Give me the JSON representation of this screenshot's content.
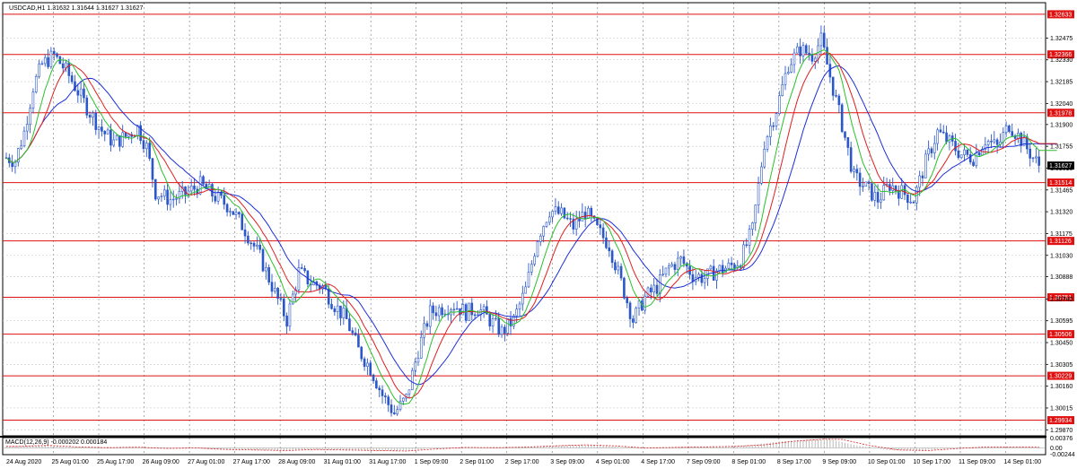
{
  "chart_data": {
    "type": "candlestick",
    "header": {
      "symbol": "USDCAD,H1",
      "ohlc": "1.31632 1.31644 1.31627 1.31627"
    },
    "price_axis": {
      "ylim": [
        1.2983,
        1.3271
      ],
      "ticks": [
        "1.32475",
        "1.32330",
        "1.32185",
        "1.32040",
        "1.31900",
        "1.31755",
        "1.31610",
        "1.31465",
        "1.31320",
        "1.31175",
        "1.31030",
        "1.30888",
        "1.30740",
        "1.30595",
        "1.30450",
        "1.30305",
        "1.30160",
        "1.30015",
        "1.29870"
      ],
      "current_price": "1.31627"
    },
    "levels": [
      {
        "label": "1.32633",
        "value": 1.32633
      },
      {
        "label": "1.32366",
        "value": 1.32366
      },
      {
        "label": "1.31978",
        "value": 1.31978
      },
      {
        "label": "1.31514",
        "value": 1.31514
      },
      {
        "label": "1.31126",
        "value": 1.31126
      },
      {
        "label": "1.30751",
        "value": 1.30751
      },
      {
        "label": "1.30506",
        "value": 1.30506
      },
      {
        "label": "1.30229",
        "value": 1.30229
      },
      {
        "label": "1.29934",
        "value": 1.29934
      }
    ],
    "time_labels": [
      "24 Aug 2020",
      "25 Aug 01:00",
      "25 Aug 17:00",
      "26 Aug 09:00",
      "27 Aug 01:00",
      "27 Aug 17:00",
      "28 Aug 09:00",
      "31 Aug 01:00",
      "31 Aug 17:00",
      "1 Sep 09:00",
      "2 Sep 01:00",
      "2 Sep 17:00",
      "3 Sep 09:00",
      "4 Sep 01:00",
      "4 Sep 17:00",
      "7 Sep 09:00",
      "8 Sep 01:00",
      "8 Sep 17:00",
      "9 Sep 09:00",
      "10 Sep 01:00",
      "10 Sep 17:00",
      "11 Sep 09:00",
      "14 Sep 01:00"
    ],
    "series_anchors": [
      [
        0,
        1.3168
      ],
      [
        3,
        1.3166
      ],
      [
        6,
        1.3185
      ],
      [
        9,
        1.3215
      ],
      [
        12,
        1.323
      ],
      [
        16,
        1.3236
      ],
      [
        20,
        1.3226
      ],
      [
        24,
        1.3212
      ],
      [
        28,
        1.3198
      ],
      [
        32,
        1.3186
      ],
      [
        36,
        1.3178
      ],
      [
        40,
        1.3182
      ],
      [
        44,
        1.3188
      ],
      [
        47,
        1.3175
      ],
      [
        50,
        1.3145
      ],
      [
        55,
        1.314
      ],
      [
        60,
        1.3144
      ],
      [
        65,
        1.315
      ],
      [
        70,
        1.3142
      ],
      [
        75,
        1.3135
      ],
      [
        80,
        1.312
      ],
      [
        85,
        1.3102
      ],
      [
        90,
        1.3078
      ],
      [
        94,
        1.306
      ],
      [
        98,
        1.3092
      ],
      [
        102,
        1.3085
      ],
      [
        106,
        1.3082
      ],
      [
        110,
        1.307
      ],
      [
        114,
        1.306
      ],
      [
        118,
        1.304
      ],
      [
        122,
        1.3028
      ],
      [
        126,
        1.301
      ],
      [
        130,
        1.2998
      ],
      [
        134,
        1.3008
      ],
      [
        138,
        1.304
      ],
      [
        142,
        1.3065
      ],
      [
        146,
        1.3068
      ],
      [
        150,
        1.307
      ],
      [
        154,
        1.3065
      ],
      [
        158,
        1.3068
      ],
      [
        162,
        1.306
      ],
      [
        166,
        1.3052
      ],
      [
        170,
        1.306
      ],
      [
        174,
        1.308
      ],
      [
        178,
        1.3115
      ],
      [
        182,
        1.3133
      ],
      [
        186,
        1.313
      ],
      [
        190,
        1.3122
      ],
      [
        194,
        1.3132
      ],
      [
        198,
        1.312
      ],
      [
        202,
        1.311
      ],
      [
        206,
        1.3085
      ],
      [
        210,
        1.306
      ],
      [
        214,
        1.3075
      ],
      [
        218,
        1.3082
      ],
      [
        222,
        1.3095
      ],
      [
        226,
        1.31
      ],
      [
        230,
        1.309
      ],
      [
        234,
        1.3088
      ],
      [
        238,
        1.3093
      ],
      [
        242,
        1.3095
      ],
      [
        246,
        1.31
      ],
      [
        250,
        1.312
      ],
      [
        254,
        1.3178
      ],
      [
        258,
        1.32
      ],
      [
        262,
        1.323
      ],
      [
        266,
        1.324
      ],
      [
        270,
        1.3236
      ],
      [
        273,
        1.3246
      ],
      [
        276,
        1.3222
      ],
      [
        280,
        1.319
      ],
      [
        284,
        1.3155
      ],
      [
        288,
        1.3148
      ],
      [
        292,
        1.314
      ],
      [
        296,
        1.315
      ],
      [
        300,
        1.3145
      ],
      [
        304,
        1.314
      ],
      [
        308,
        1.3165
      ],
      [
        312,
        1.3185
      ],
      [
        316,
        1.3178
      ],
      [
        320,
        1.317
      ],
      [
        324,
        1.3168
      ],
      [
        328,
        1.318
      ],
      [
        332,
        1.3175
      ],
      [
        336,
        1.319
      ],
      [
        340,
        1.318
      ],
      [
        344,
        1.3168
      ],
      [
        346,
        1.3163
      ]
    ],
    "bars_count": 347,
    "ma_periods": {
      "blue": 21,
      "red": 13,
      "green": 8
    },
    "macd": {
      "label": "MACD(12,26,9) -0.000202 0.000184",
      "ticks": [
        "0.00376",
        "0.00",
        "-0.00244"
      ],
      "ylim": [
        -0.0026,
        0.004
      ],
      "hist_anchors": [
        [
          0,
          0.0006
        ],
        [
          10,
          0.001
        ],
        [
          20,
          0.0004
        ],
        [
          30,
          0.0001
        ],
        [
          40,
          0.0003
        ],
        [
          50,
          -0.0002
        ],
        [
          60,
          0.0
        ],
        [
          70,
          -0.0006
        ],
        [
          80,
          -0.0008
        ],
        [
          90,
          -0.001
        ],
        [
          100,
          -0.0006
        ],
        [
          110,
          -0.0008
        ],
        [
          120,
          -0.001
        ],
        [
          130,
          -0.0012
        ],
        [
          140,
          -0.0004
        ],
        [
          150,
          0.0002
        ],
        [
          160,
          0.0001
        ],
        [
          170,
          0.0003
        ],
        [
          180,
          0.0008
        ],
        [
          190,
          0.0012
        ],
        [
          200,
          0.0008
        ],
        [
          210,
          0.0
        ],
        [
          220,
          0.0002
        ],
        [
          230,
          0.0004
        ],
        [
          240,
          0.0006
        ],
        [
          250,
          0.0012
        ],
        [
          260,
          0.0026
        ],
        [
          270,
          0.0034
        ],
        [
          276,
          0.0033
        ],
        [
          285,
          0.001
        ],
        [
          295,
          -0.0008
        ],
        [
          305,
          -0.001
        ],
        [
          315,
          -0.0002
        ],
        [
          325,
          0.0004
        ],
        [
          335,
          0.0004
        ],
        [
          346,
          0.0002
        ]
      ]
    },
    "colors": {
      "bull": "#2b57c9",
      "bear": "#2b57c9",
      "ma_blue": "#1c2fd8",
      "ma_red": "#e01f1f",
      "ma_green": "#2ac02a",
      "level_line": "#e01010",
      "grid": "#c9c9c9",
      "macd_signal": "#e01f1f",
      "macd_hist": "#b9b9b9"
    }
  }
}
